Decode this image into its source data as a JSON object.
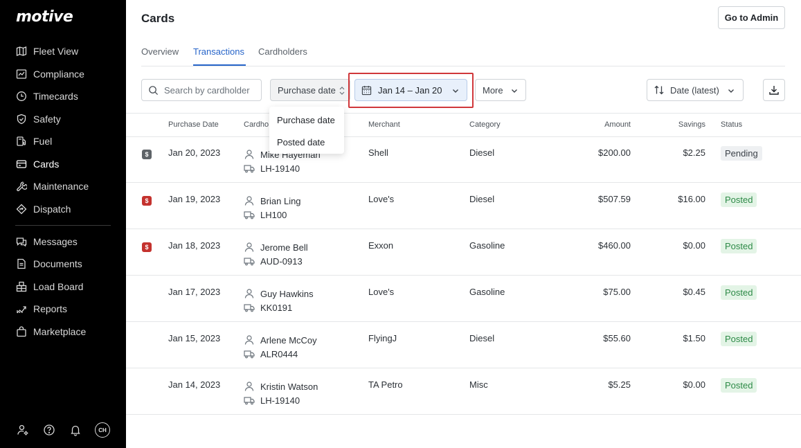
{
  "sidebar": {
    "logo": "motive",
    "items": [
      {
        "label": "Fleet View",
        "icon": "map-icon"
      },
      {
        "label": "Compliance",
        "icon": "compliance-icon"
      },
      {
        "label": "Timecards",
        "icon": "clock-icon"
      },
      {
        "label": "Safety",
        "icon": "shield-icon"
      },
      {
        "label": "Fuel",
        "icon": "fuel-icon"
      },
      {
        "label": "Cards",
        "icon": "card-icon"
      },
      {
        "label": "Maintenance",
        "icon": "wrench-icon"
      },
      {
        "label": "Dispatch",
        "icon": "dispatch-icon"
      },
      {
        "label": "Messages",
        "icon": "messages-icon"
      },
      {
        "label": "Documents",
        "icon": "document-icon"
      },
      {
        "label": "Load Board",
        "icon": "load-board-icon"
      },
      {
        "label": "Reports",
        "icon": "reports-icon"
      },
      {
        "label": "Marketplace",
        "icon": "marketplace-icon"
      }
    ],
    "avatar_initials": "CH"
  },
  "header": {
    "title": "Cards",
    "admin_button": "Go to Admin"
  },
  "tabs": [
    {
      "label": "Overview"
    },
    {
      "label": "Transactions",
      "active": true
    },
    {
      "label": "Cardholders"
    }
  ],
  "filters": {
    "search_placeholder": "Search by cardholder",
    "date_type": "Purchase date",
    "date_range": "Jan 14 – Jan 20",
    "more": "More",
    "sort": "Date (latest)"
  },
  "date_type_dropdown": {
    "options": [
      "Purchase date",
      "Posted date"
    ]
  },
  "table": {
    "columns": {
      "purchase_date": "Purchase Date",
      "cardholder": "Cardho",
      "merchant": "Merchant",
      "category": "Category",
      "amount": "Amount",
      "savings": "Savings",
      "status": "Status"
    },
    "rows": [
      {
        "badge": "$",
        "badge_color": "#5e6368",
        "date": "Jan 20, 2023",
        "name": "Mike Hayeman",
        "vehicle": "LH-19140",
        "merchant": "Shell",
        "category": "Diesel",
        "amount": "$200.00",
        "savings": "$2.25",
        "status": "Pending"
      },
      {
        "badge": "$",
        "badge_color": "#c4322e",
        "date": "Jan 19, 2023",
        "name": "Brian Ling",
        "vehicle": "LH100",
        "merchant": "Love's",
        "category": "Diesel",
        "amount": "$507.59",
        "savings": "$16.00",
        "status": "Posted"
      },
      {
        "badge": "$",
        "badge_color": "#c4322e",
        "date": "Jan 18, 2023",
        "name": "Jerome Bell",
        "vehicle": "AUD-0913",
        "merchant": "Exxon",
        "category": "Gasoline",
        "amount": "$460.00",
        "savings": "$0.00",
        "status": "Posted"
      },
      {
        "badge": "",
        "date": "Jan 17, 2023",
        "name": "Guy Hawkins",
        "vehicle": "KK0191",
        "merchant": "Love's",
        "category": "Gasoline",
        "amount": "$75.00",
        "savings": "$0.45",
        "status": "Posted"
      },
      {
        "badge": "",
        "date": "Jan 15, 2023",
        "name": "Arlene McCoy",
        "vehicle": "ALR0444",
        "merchant": "FlyingJ",
        "category": "Diesel",
        "amount": "$55.60",
        "savings": "$1.50",
        "status": "Posted"
      },
      {
        "badge": "",
        "date": "Jan 14, 2023",
        "name": "Kristin Watson",
        "vehicle": "LH-19140",
        "merchant": "TA Petro",
        "category": "Misc",
        "amount": "$5.25",
        "savings": "$0.00",
        "status": "Posted"
      }
    ]
  },
  "colors": {
    "accent": "#2664c9",
    "highlight": "#d0373a",
    "posted": "#2d8a47",
    "sidebar_bg": "#000000"
  }
}
